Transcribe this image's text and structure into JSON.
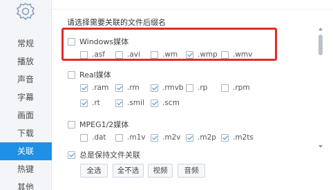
{
  "sidebar": {
    "items": [
      {
        "label": "常规",
        "active": false
      },
      {
        "label": "播放",
        "active": false
      },
      {
        "label": "声音",
        "active": false
      },
      {
        "label": "字幕",
        "active": false
      },
      {
        "label": "画面",
        "active": false
      },
      {
        "label": "下载",
        "active": false
      },
      {
        "label": "关联",
        "active": true
      },
      {
        "label": "热键",
        "active": false
      },
      {
        "label": "其他",
        "active": false
      }
    ]
  },
  "main": {
    "heading": "请选择需要关联的文件后缀名",
    "groups": [
      {
        "label": "Windows媒体",
        "checked": false,
        "extensions": [
          {
            "label": ".asf",
            "checked": false
          },
          {
            "label": ".avi",
            "checked": false
          },
          {
            "label": ".wm",
            "checked": false
          },
          {
            "label": ".wmp",
            "checked": true
          },
          {
            "label": ".wmv",
            "checked": false
          }
        ]
      },
      {
        "label": "Real媒体",
        "checked": false,
        "extensions": [
          {
            "label": ".ram",
            "checked": true
          },
          {
            "label": ".rm",
            "checked": true
          },
          {
            "label": ".rmvb",
            "checked": true
          },
          {
            "label": ".rp",
            "checked": false
          },
          {
            "label": ".rpm",
            "checked": false
          },
          {
            "label": ".rt",
            "checked": true
          },
          {
            "label": ".smil",
            "checked": true
          },
          {
            "label": ".scm",
            "checked": true
          }
        ]
      },
      {
        "label": "MPEG1/2媒体",
        "checked": false,
        "extensions": [
          {
            "label": ".dat",
            "checked": false
          },
          {
            "label": ".m1v",
            "checked": false
          },
          {
            "label": ".m2v",
            "checked": true
          },
          {
            "label": ".m2p",
            "checked": true
          },
          {
            "label": ".m2ts",
            "checked": true
          }
        ]
      }
    ],
    "always_keep": {
      "label": "总是保持文件关联",
      "checked": true
    },
    "buttons": {
      "select_all": "全选",
      "select_none": "全不选",
      "video": "视频",
      "audio": "音频"
    }
  },
  "colors": {
    "accent": "#1e90e6",
    "highlight": "#e02a2a",
    "sidebar_bg": "#f3f5f8"
  },
  "icons": {
    "logo": "gear-icon",
    "checkbox_checked": "check-icon"
  }
}
